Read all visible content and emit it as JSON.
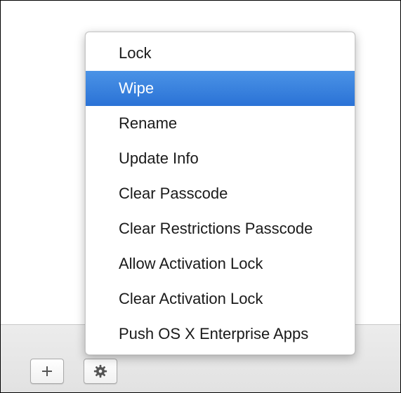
{
  "toolbar": {
    "add_icon": "plus-icon",
    "action_icon": "gear-icon"
  },
  "menu": {
    "selected_index": 1,
    "highlight_color": "#3a83e0",
    "items": [
      {
        "label": "Lock"
      },
      {
        "label": "Wipe"
      },
      {
        "label": "Rename"
      },
      {
        "label": "Update Info"
      },
      {
        "label": "Clear Passcode"
      },
      {
        "label": "Clear Restrictions Passcode"
      },
      {
        "label": "Allow Activation Lock"
      },
      {
        "label": "Clear Activation Lock"
      },
      {
        "label": "Push OS X Enterprise Apps"
      }
    ]
  }
}
